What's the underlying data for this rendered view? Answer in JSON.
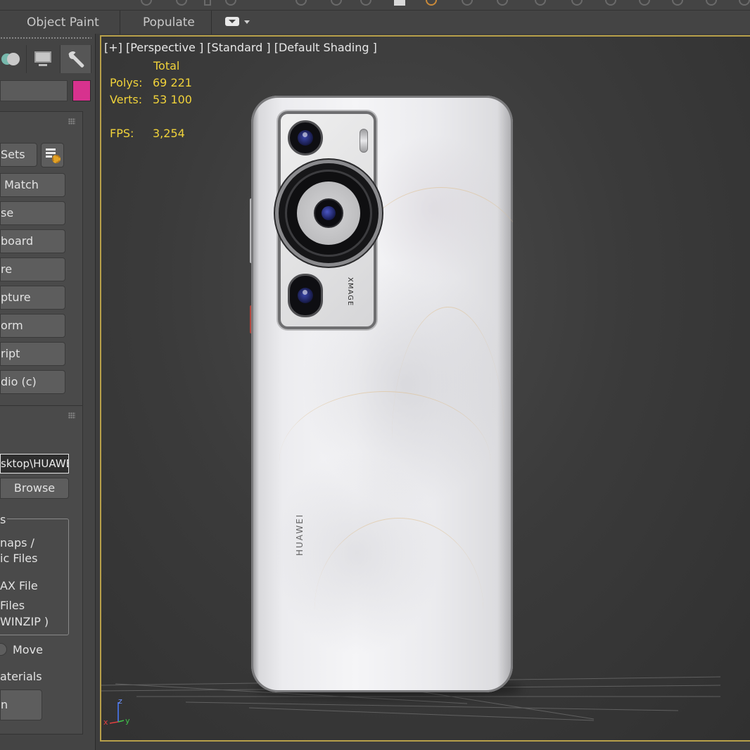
{
  "ribbon": {
    "tabs": [
      "Object Paint",
      "Populate"
    ]
  },
  "command_panel": {
    "accent_color": "#d7328e",
    "tab_icons": [
      "display-sphere-icon",
      "monitor-icon",
      "wrench-icon"
    ],
    "utilities": {
      "sets_label": "Sets",
      "buttons": [
        "Match",
        "se",
        "board",
        "re",
        "pture",
        "orm",
        "ript",
        "dio (c)"
      ]
    },
    "script": {
      "path_value": "sktop\\HUAWE",
      "browse_label": "Browse",
      "group_title": "s",
      "options": [
        "naps /",
        "ic Files",
        "AX File",
        "Files",
        "WINZIP )"
      ],
      "move_label": "Move",
      "materials_label": "aterials",
      "bottom_button": "n"
    }
  },
  "viewport": {
    "label": "[+] [Perspective ] [Standard ] [Default Shading ]",
    "stats": {
      "header": "Total",
      "polys_label": "Polys:",
      "polys_value": "69 221",
      "verts_label": "Verts:",
      "verts_value": "53 100",
      "fps_label": "FPS:",
      "fps_value": "3,254"
    },
    "border_color": "#b8a04a",
    "stats_color": "#f0d23a",
    "model": {
      "camera_badge": "XMAGE",
      "brand": "HUAWEI"
    },
    "axis": {
      "x": "x",
      "y": "y",
      "z": "z"
    }
  }
}
